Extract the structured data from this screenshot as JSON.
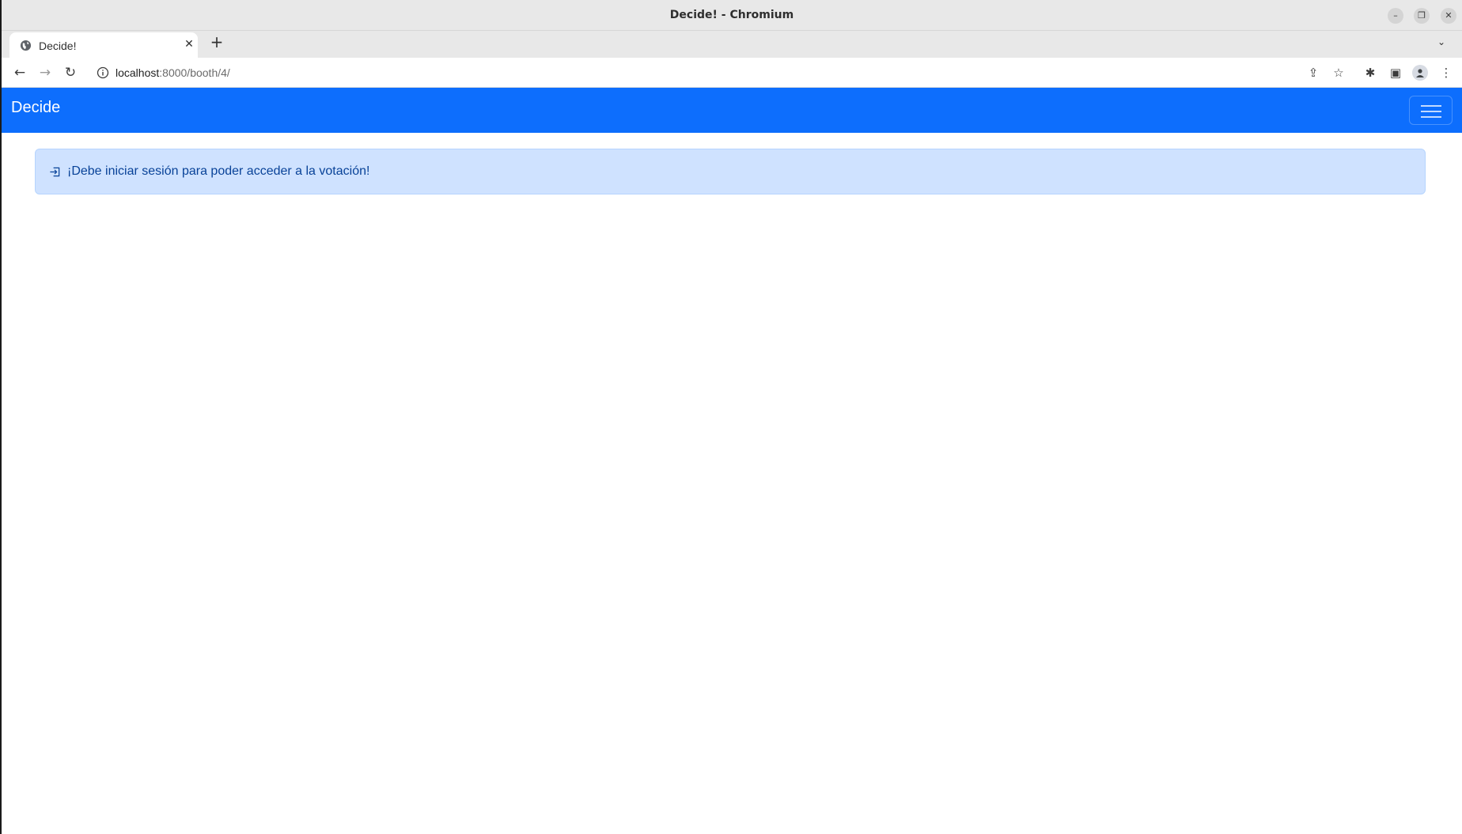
{
  "window": {
    "title": "Decide! - Chromium",
    "minimize_glyph": "–",
    "maximize_glyph": "❐",
    "close_glyph": "✕"
  },
  "tabs": [
    {
      "title": "Decide!",
      "favicon": "globe-icon",
      "close_glyph": "✕"
    }
  ],
  "tabstrip": {
    "new_tab_glyph": "+",
    "tab_search_glyph": "⌄"
  },
  "toolbar": {
    "back_glyph": "←",
    "forward_glyph": "→",
    "reload_glyph": "↻",
    "url_host": "localhost",
    "url_rest": ":8000/booth/4/",
    "share_glyph": "⇪",
    "bookmark_glyph": "☆",
    "extensions_glyph": "✱",
    "side_panel_glyph": "▣",
    "menu_glyph": "⋮"
  },
  "navbar": {
    "brand": "Decide",
    "background": "#0d6efd"
  },
  "alert": {
    "message": "¡Debe iniciar sesión para poder acceder a la votación!",
    "icon": "box-arrow-in-right-icon",
    "background": "#cfe2ff",
    "text_color": "#084298"
  }
}
